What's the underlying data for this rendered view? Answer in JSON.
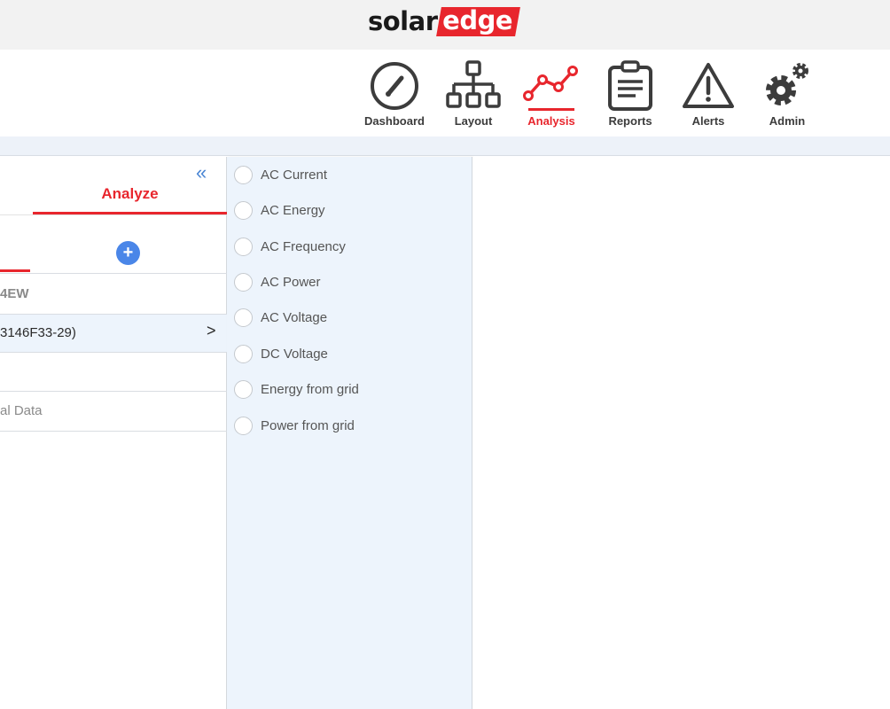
{
  "brand": {
    "solar": "solar",
    "edge": "edge",
    "accent_color": "#e8262d"
  },
  "nav": {
    "items": [
      {
        "label": "Dashboard",
        "icon": "gauge-icon",
        "active": false
      },
      {
        "label": "Layout",
        "icon": "sitemap-icon",
        "active": false
      },
      {
        "label": "Analysis",
        "icon": "line-chart-icon",
        "active": true
      },
      {
        "label": "Reports",
        "icon": "clipboard-icon",
        "active": false
      },
      {
        "label": "Alerts",
        "icon": "warning-icon",
        "active": false
      },
      {
        "label": "Admin",
        "icon": "gears-icon",
        "active": false
      }
    ]
  },
  "left_panel": {
    "collapse_icon": "«",
    "tab_label": "Analyze",
    "add_icon": "+",
    "site_name": "4EW",
    "device_label": "3146F33-29)",
    "device_arrow": ">",
    "data_label": "al Data"
  },
  "parameters": {
    "items": [
      "AC Current",
      "AC Energy",
      "AC Frequency",
      "AC Power",
      "AC Voltage",
      "DC Voltage",
      "Energy from grid",
      "Power from grid"
    ]
  }
}
